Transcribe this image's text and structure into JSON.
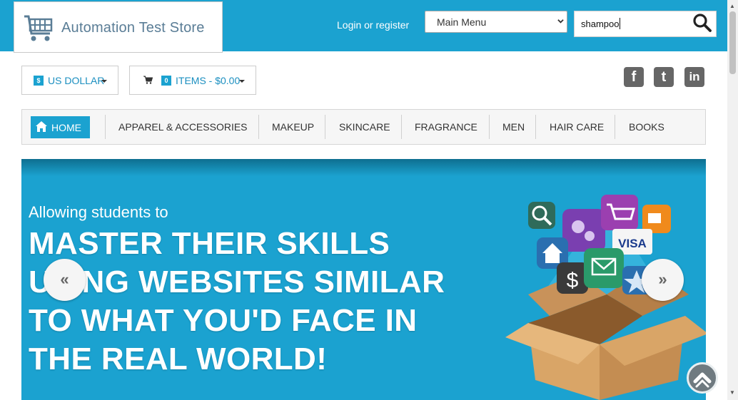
{
  "header": {
    "logo_text": "Automation Test Store",
    "login_label": "Login or register",
    "main_menu_value": "Main Menu",
    "search_value": "shampoo"
  },
  "toolbar": {
    "currency_label": "US DOLLAR",
    "currency_badge": "$",
    "cart_count": "0",
    "cart_label": "ITEMS - $0.00"
  },
  "social": {
    "facebook": "f",
    "twitter": "t",
    "linkedin": "in"
  },
  "nav": {
    "home": "HOME",
    "items": [
      "APPAREL & ACCESSORIES",
      "MAKEUP",
      "SKINCARE",
      "FRAGRANCE",
      "MEN",
      "HAIR CARE",
      "BOOKS"
    ]
  },
  "banner": {
    "subtitle": "Allowing students to",
    "line1": "MASTER THEIR SKILLS",
    "line2": "USING WEBSITES SIMILAR",
    "line3": "TO WHAT YOU'D FACE IN",
    "line4": "THE REAL WORLD!",
    "prev": "«",
    "next": "»",
    "visa_text": "VISA"
  },
  "colors": {
    "brand": "#1ba2d0",
    "logo_text": "#5a7d96"
  }
}
